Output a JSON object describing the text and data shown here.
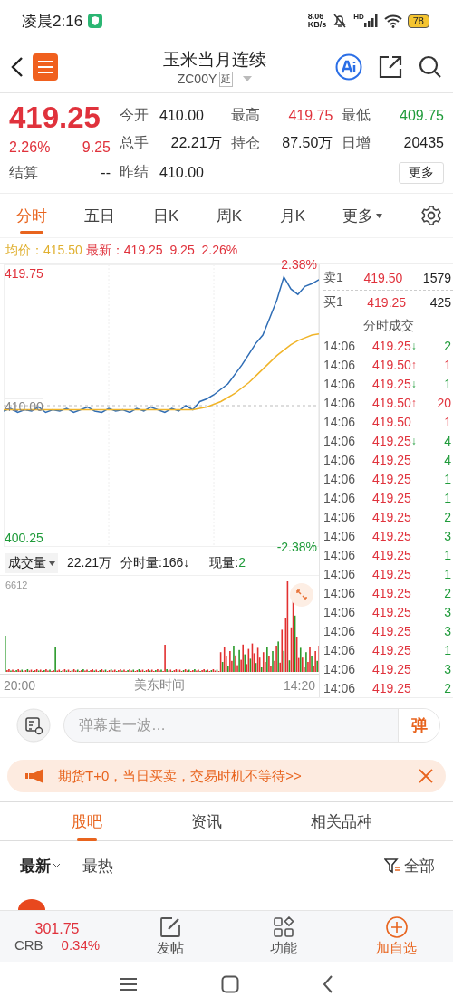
{
  "status_bar": {
    "time": "凌晨2:16",
    "speed_value": "8.06",
    "speed_unit": "KB/s",
    "network": "HD",
    "battery": "78"
  },
  "header": {
    "title": "玉米当月连续",
    "code": "ZC00Y",
    "badge": "延"
  },
  "quote": {
    "price": "419.25",
    "change_pct": "2.26%",
    "change": "9.25",
    "color": "#e0323c",
    "settle_label": "结算",
    "settle_value": "--",
    "more_button": "更多",
    "fields": [
      {
        "label": "今开",
        "value": "410.00",
        "color": "#222222"
      },
      {
        "label": "最高",
        "value": "419.75",
        "color": "#e0323c"
      },
      {
        "label": "最低",
        "value": "409.75",
        "color": "#1f9b3a"
      },
      {
        "label": "总手",
        "value": "22.21万",
        "color": "#222222"
      },
      {
        "label": "持仓",
        "value": "87.50万",
        "color": "#222222"
      },
      {
        "label": "日增",
        "value": "20435",
        "color": "#222222"
      },
      {
        "label": "昨结",
        "value": "410.00",
        "color": "#222222"
      }
    ]
  },
  "chart_tabs": [
    {
      "label": "分时",
      "selected": true,
      "caret": false
    },
    {
      "label": "五日",
      "selected": false,
      "caret": false
    },
    {
      "label": "日K",
      "selected": false,
      "caret": false
    },
    {
      "label": "周K",
      "selected": false,
      "caret": false
    },
    {
      "label": "月K",
      "selected": false,
      "caret": false
    },
    {
      "label": "更多",
      "selected": false,
      "caret": true
    }
  ],
  "chart_info": {
    "avg": "均价：415.50",
    "latest_label": "最新：",
    "latest_value": "419.25",
    "latest_change": "9.25",
    "latest_pct": "2.26%"
  },
  "price_chart": {
    "high_pct": "2.38%",
    "low_pct": "-2.38%",
    "chart_data": {
      "type": "line",
      "ylim": [
        399.58,
        420.42
      ],
      "yticks": [
        {
          "value": 419.75,
          "label": "419.75"
        },
        {
          "value": 410,
          "label": "410.00"
        },
        {
          "value": 400.25,
          "label": "400.25"
        }
      ],
      "series": [
        {
          "color": "#bbbbbb",
          "line_style": "dashed",
          "values": [
            410,
            410,
            410,
            410,
            410,
            410,
            410,
            410,
            410,
            410,
            410,
            410,
            410,
            410,
            410,
            410,
            410,
            410,
            410,
            410,
            410,
            410,
            410,
            410,
            410,
            410,
            410,
            410,
            410,
            410,
            410,
            410,
            410,
            410,
            410,
            410,
            410,
            410,
            410,
            410,
            410,
            410,
            410,
            410,
            410,
            410
          ]
        },
        {
          "color": "#2f6db5",
          "values": [
            409.6,
            409.8,
            409.5,
            409.7,
            409.6,
            409.9,
            409.5,
            409.7,
            409.6,
            409.8,
            409.5,
            409.7,
            409.9,
            409.6,
            409.5,
            409.8,
            409.6,
            409.7,
            409.5,
            409.8,
            409.6,
            409.9,
            409.7,
            409.5,
            409.8,
            409.6,
            410.0,
            409.7,
            410.3,
            410.5,
            410.8,
            411.2,
            411.6,
            412.3,
            413.0,
            413.8,
            414.6,
            415.2,
            416.5,
            417.8,
            419.5,
            418.6,
            418.2,
            418.8,
            419.0,
            419.3
          ]
        },
        {
          "color": "#f0b429",
          "values": [
            409.7,
            409.7,
            409.7,
            409.7,
            409.7,
            409.7,
            409.7,
            409.7,
            409.7,
            409.7,
            409.7,
            409.7,
            409.7,
            409.7,
            409.7,
            409.7,
            409.7,
            409.7,
            409.7,
            409.7,
            409.7,
            409.7,
            409.7,
            409.7,
            409.7,
            409.7,
            409.7,
            409.7,
            409.8,
            409.9,
            410.1,
            410.3,
            410.6,
            410.9,
            411.3,
            411.7,
            412.2,
            412.7,
            413.2,
            413.7,
            414.1,
            414.5,
            414.8,
            415.0,
            415.2,
            415.3
          ]
        }
      ]
    }
  },
  "order_book": [
    {
      "label": "卖1",
      "price": "419.50",
      "volume": "1579"
    },
    {
      "label": "买1",
      "price": "419.25",
      "volume": "425"
    }
  ],
  "trades_title": "分时成交",
  "trades": [
    {
      "time": "14:06",
      "price": "419.25",
      "arrow": "↓",
      "color": "#1f9b3a",
      "volume": "2"
    },
    {
      "time": "14:06",
      "price": "419.50",
      "arrow": "↑",
      "color": "#e0323c",
      "volume": "1"
    },
    {
      "time": "14:06",
      "price": "419.25",
      "arrow": "↓",
      "color": "#1f9b3a",
      "volume": "1"
    },
    {
      "time": "14:06",
      "price": "419.50",
      "arrow": "↑",
      "color": "#e0323c",
      "volume": "20"
    },
    {
      "time": "14:06",
      "price": "419.50",
      "color": "#e0323c",
      "volume": "1"
    },
    {
      "time": "14:06",
      "price": "419.25",
      "arrow": "↓",
      "color": "#1f9b3a",
      "volume": "4"
    },
    {
      "time": "14:06",
      "price": "419.25",
      "color": "#1f9b3a",
      "volume": "4"
    },
    {
      "time": "14:06",
      "price": "419.25",
      "color": "#1f9b3a",
      "volume": "1"
    },
    {
      "time": "14:06",
      "price": "419.25",
      "color": "#1f9b3a",
      "volume": "1"
    },
    {
      "time": "14:06",
      "price": "419.25",
      "color": "#1f9b3a",
      "volume": "2"
    },
    {
      "time": "14:06",
      "price": "419.25",
      "color": "#1f9b3a",
      "volume": "3"
    },
    {
      "time": "14:06",
      "price": "419.25",
      "color": "#1f9b3a",
      "volume": "1"
    },
    {
      "time": "14:06",
      "price": "419.25",
      "color": "#1f9b3a",
      "volume": "1"
    },
    {
      "time": "14:06",
      "price": "419.25",
      "color": "#1f9b3a",
      "volume": "2"
    },
    {
      "time": "14:06",
      "price": "419.25",
      "color": "#1f9b3a",
      "volume": "3"
    },
    {
      "time": "14:06",
      "price": "419.25",
      "color": "#1f9b3a",
      "volume": "3"
    },
    {
      "time": "14:06",
      "price": "419.25",
      "color": "#1f9b3a",
      "volume": "1"
    },
    {
      "time": "14:06",
      "price": "419.25",
      "color": "#1f9b3a",
      "volume": "3"
    },
    {
      "time": "14:06",
      "price": "419.25",
      "color": "#1f9b3a",
      "volume": "2"
    }
  ],
  "volume": {
    "selector": "成交量",
    "total": "22.21万",
    "minute": "分时量:166↓",
    "current_label": "现量:",
    "current_value": "2",
    "max": "6612",
    "time_start": "20:00",
    "time_mid": "美东时间",
    "time_end": "14:20"
  },
  "danmaku": {
    "placeholder": "弹幕走一波…",
    "button": "弹"
  },
  "banner": {
    "text": "期货T+0，当日买卖，交易时机不等待>>"
  },
  "section_tabs": [
    {
      "label": "股吧",
      "selected": true
    },
    {
      "label": "资讯",
      "selected": false
    },
    {
      "label": "相关品种",
      "selected": false
    }
  ],
  "sort_options": [
    {
      "label": "最新",
      "selected": true,
      "caret": true
    },
    {
      "label": "最热",
      "selected": false,
      "caret": false
    }
  ],
  "filter": "全部",
  "bottom_bar": {
    "index_value": "301.75",
    "index_name": "CRB",
    "index_pct": "0.34%",
    "actions": [
      {
        "label": "发帖",
        "kind": "post",
        "highlighted": false
      },
      {
        "label": "功能",
        "kind": "grid",
        "highlighted": false
      },
      {
        "label": "加自选",
        "kind": "add",
        "highlighted": true
      }
    ]
  }
}
